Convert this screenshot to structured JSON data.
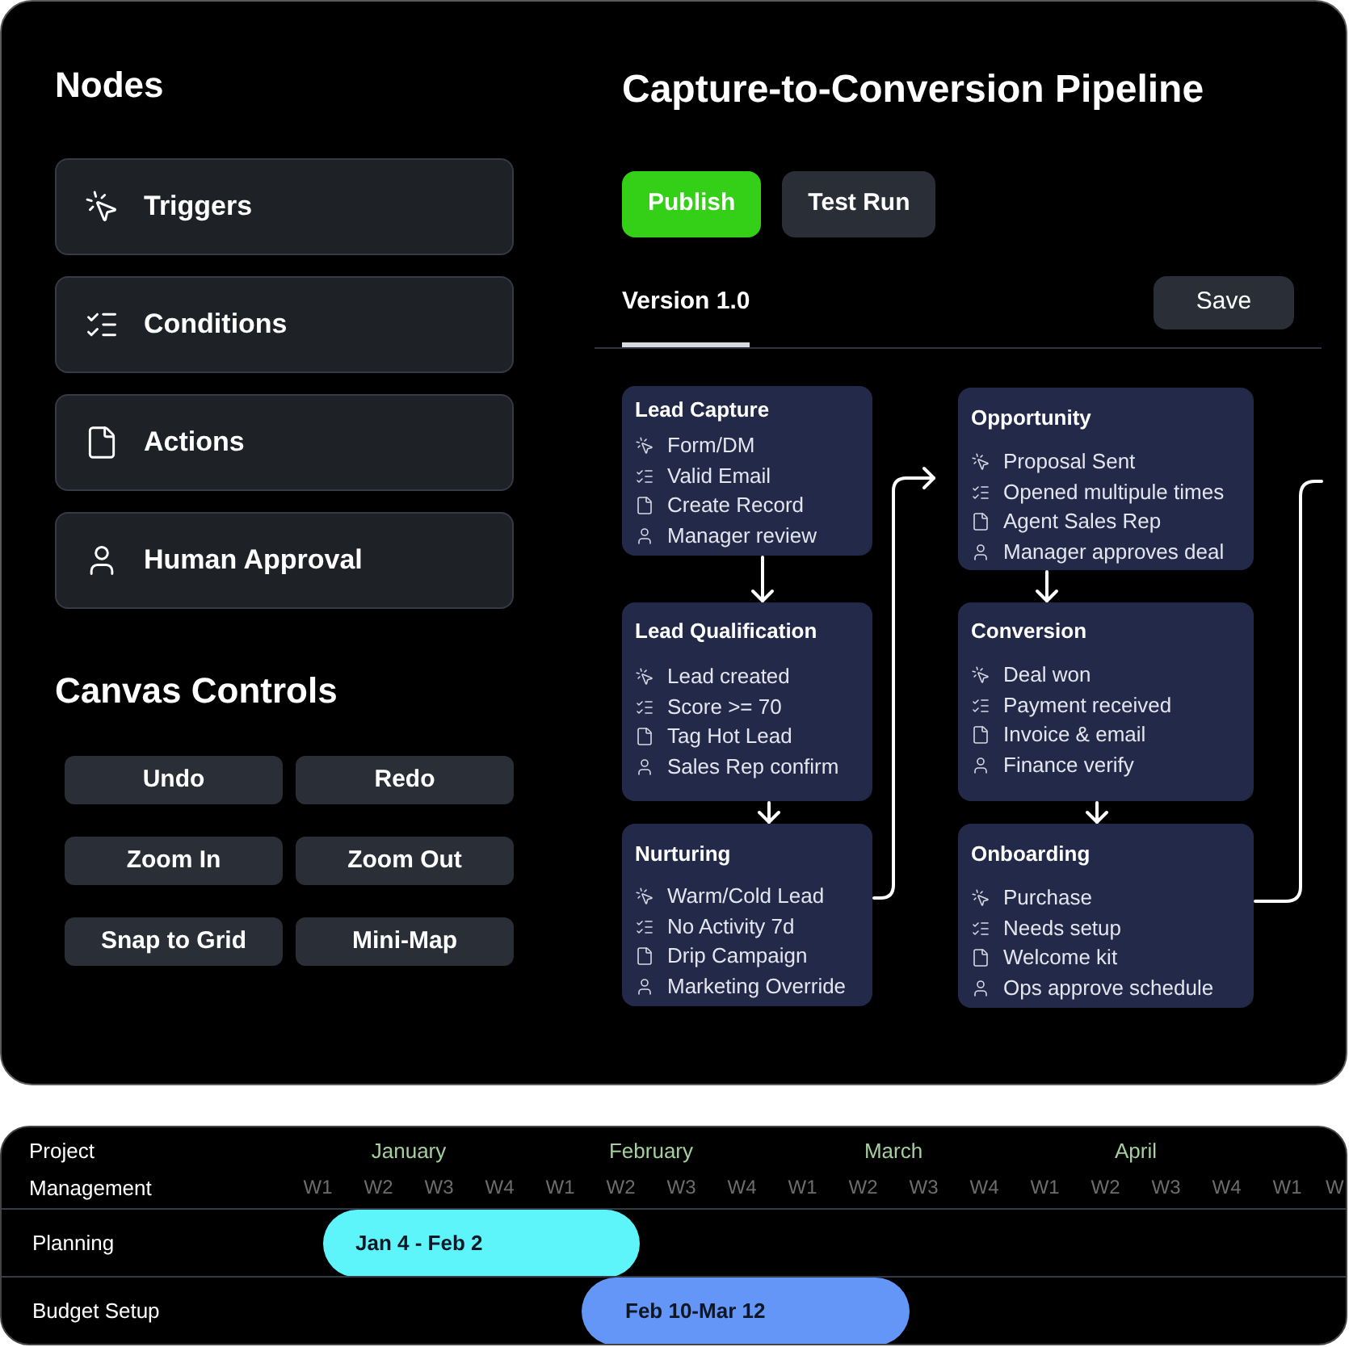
{
  "sidebar": {
    "title": "Nodes",
    "node_types": [
      {
        "kind": "trigger",
        "label": "Triggers"
      },
      {
        "kind": "condition",
        "label": "Conditions"
      },
      {
        "kind": "action",
        "label": "Actions"
      },
      {
        "kind": "approval",
        "label": "Human Approval"
      }
    ]
  },
  "canvas_controls": {
    "title": "Canvas Controls",
    "buttons": [
      "Undo",
      "Redo",
      "Zoom In",
      "Zoom Out",
      "Snap to Grid",
      "Mini-Map"
    ]
  },
  "pipeline": {
    "title": "Capture-to-Conversion Pipeline",
    "actions": [
      {
        "kind": "primary",
        "label": "Publish"
      },
      {
        "kind": "secondary",
        "label": "Test Run"
      }
    ],
    "tabs": [
      {
        "label": "Version 1.0",
        "selected": true
      }
    ],
    "save_button": "Save",
    "nodes": [
      {
        "title": "Lead Capture",
        "steps": [
          {
            "kind": "trigger",
            "label": "Form/DM"
          },
          {
            "kind": "condition",
            "label": "Valid Email"
          },
          {
            "kind": "action",
            "label": "Create Record"
          },
          {
            "kind": "approval",
            "label": "Manager review"
          }
        ]
      },
      {
        "title": "Lead Qualification",
        "steps": [
          {
            "kind": "trigger",
            "label": "Lead created"
          },
          {
            "kind": "condition",
            "label": "Score >= 70"
          },
          {
            "kind": "action",
            "label": "Tag Hot Lead"
          },
          {
            "kind": "approval",
            "label": "Sales Rep confirm"
          }
        ]
      },
      {
        "title": "Nurturing",
        "steps": [
          {
            "kind": "trigger",
            "label": "Warm/Cold Lead"
          },
          {
            "kind": "condition",
            "label": "No Activity 7d"
          },
          {
            "kind": "action",
            "label": "Drip Campaign"
          },
          {
            "kind": "approval",
            "label": "Marketing Override"
          }
        ]
      },
      {
        "title": "Opportunity",
        "steps": [
          {
            "kind": "trigger",
            "label": "Proposal Sent"
          },
          {
            "kind": "condition",
            "label": "Opened multipule times"
          },
          {
            "kind": "action",
            "label": "Agent Sales Rep"
          },
          {
            "kind": "approval",
            "label": "Manager approves deal"
          }
        ]
      },
      {
        "title": "Conversion",
        "steps": [
          {
            "kind": "trigger",
            "label": "Deal won"
          },
          {
            "kind": "condition",
            "label": "Payment received"
          },
          {
            "kind": "action",
            "label": "Invoice & email"
          },
          {
            "kind": "approval",
            "label": "Finance verify"
          }
        ]
      },
      {
        "title": "Onboarding",
        "steps": [
          {
            "kind": "trigger",
            "label": "Purchase"
          },
          {
            "kind": "condition",
            "label": "Needs setup"
          },
          {
            "kind": "action",
            "label": "Welcome kit"
          },
          {
            "kind": "approval",
            "label": "Ops approve schedule"
          }
        ]
      }
    ]
  },
  "timeline": {
    "heading": "Project Management",
    "months": [
      "January",
      "February",
      "March",
      "April"
    ],
    "weeks": [
      "W1",
      "W2",
      "W3",
      "W4",
      "W1",
      "W2",
      "W3",
      "W4",
      "W1",
      "W2",
      "W3",
      "W4",
      "W1",
      "W2",
      "W3",
      "W4",
      "W1",
      "W"
    ],
    "rows": [
      {
        "label": "Planning",
        "range": "Jan 4 - Feb 2",
        "color": "#5ef5fa"
      },
      {
        "label": "Budget Setup",
        "range": "Feb 10-Mar 12",
        "color": "#6496f8"
      }
    ]
  }
}
